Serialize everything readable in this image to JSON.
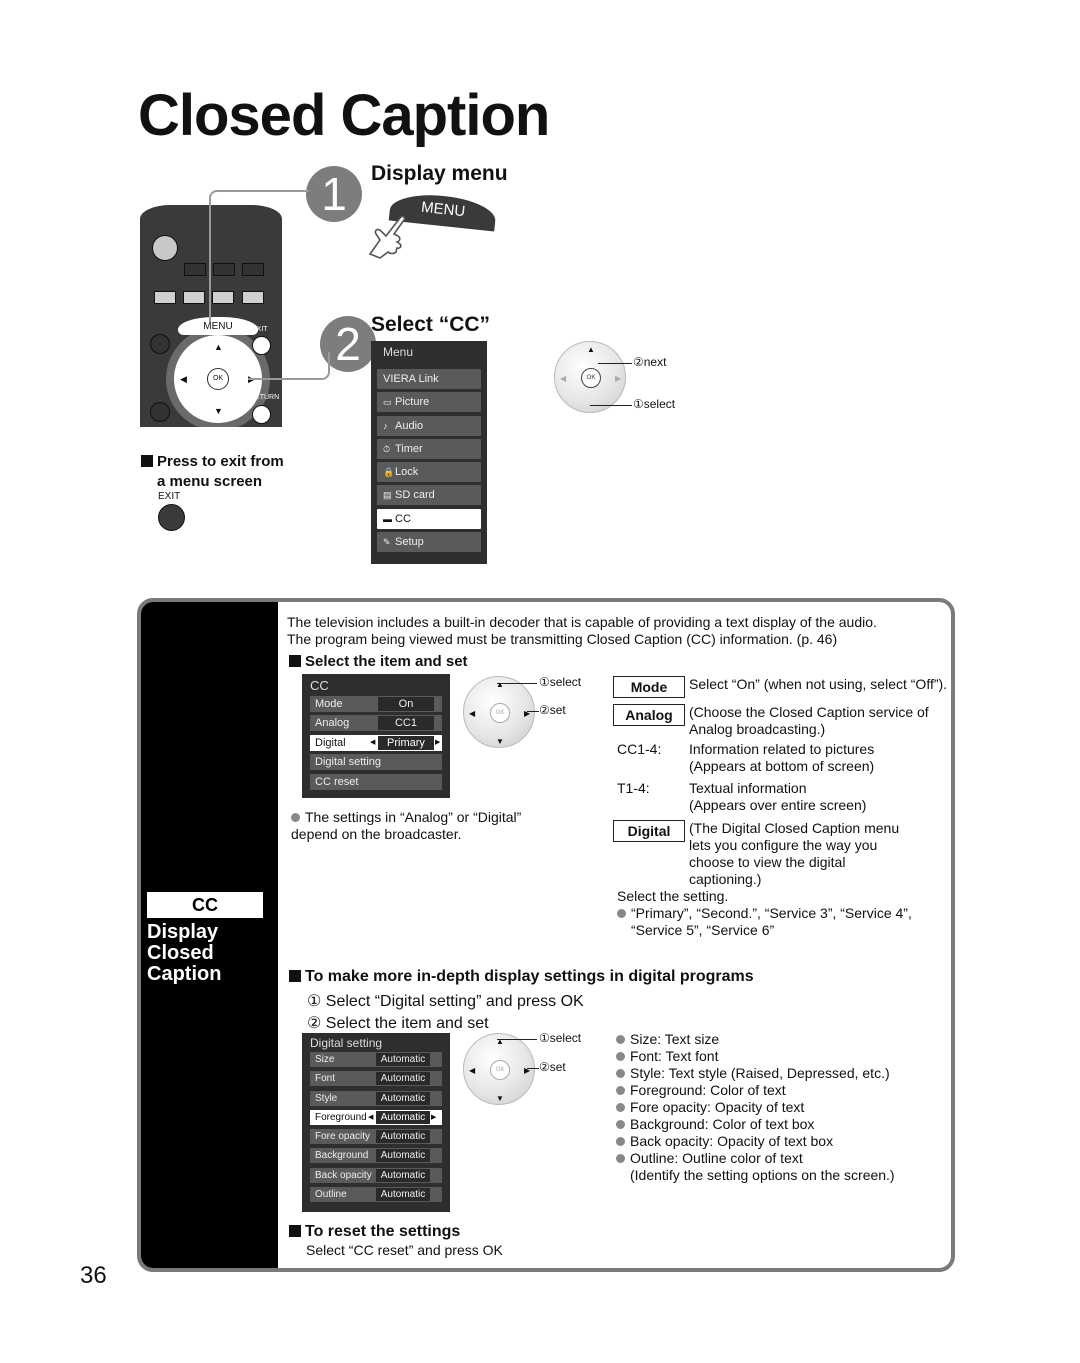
{
  "page": {
    "title": "Closed Caption",
    "page_number": "36"
  },
  "step1": {
    "number": "1",
    "heading": "Display menu",
    "menu_button_label": "MENU"
  },
  "step2": {
    "number": "2",
    "heading": "Select “CC”"
  },
  "remote": {
    "menu_label": "MENU",
    "exit_label": "EXIT",
    "return_label": "RETURN",
    "ok_label": "OK"
  },
  "tv_menu": {
    "header": "Menu",
    "items": [
      {
        "icon": "",
        "label": "VIERA Link",
        "selected": false
      },
      {
        "icon": "▭",
        "label": "Picture",
        "selected": false
      },
      {
        "icon": "♪",
        "label": "Audio",
        "selected": false
      },
      {
        "icon": "⏱",
        "label": "Timer",
        "selected": false
      },
      {
        "icon": "🔒",
        "label": "Lock",
        "selected": false
      },
      {
        "icon": "▤",
        "label": "SD card",
        "selected": false
      },
      {
        "icon": "▬",
        "label": "CC",
        "selected": true
      },
      {
        "icon": "✎",
        "label": "Setup",
        "selected": false
      }
    ]
  },
  "nav_pad_top": {
    "ok": "OK",
    "next_label": "②next",
    "select_label": "①select"
  },
  "exit_note": {
    "line1": "Press to exit from",
    "line2": "a menu screen",
    "exit_label": "EXIT"
  },
  "sidebar": {
    "badge": "CC",
    "title_lines": [
      "Display",
      "Closed",
      "Caption"
    ]
  },
  "intro": {
    "line1": "The television includes a built-in decoder that is capable of providing a text display of the audio.",
    "line2": "The program being viewed must be transmitting Closed Caption (CC) information. (p. 46)"
  },
  "select_item": {
    "heading": "Select the item and set",
    "cc_menu": {
      "title": "CC",
      "rows": [
        {
          "label": "Mode",
          "value": "On",
          "selected": false
        },
        {
          "label": "Analog",
          "value": "CC1",
          "selected": false
        },
        {
          "label": "Digital",
          "value": "Primary",
          "selected": true
        },
        {
          "label": "Digital setting",
          "value": "",
          "selected": false
        },
        {
          "label": "CC reset",
          "value": "",
          "selected": false
        }
      ]
    },
    "pad": {
      "ok": "OK",
      "select_label": "①select",
      "set_label": "②set"
    },
    "note": "The settings in “Analog” or “Digital” depend on the broadcaster."
  },
  "definitions": {
    "mode": {
      "label": "Mode",
      "text": "Select “On” (when not using, select “Off”)."
    },
    "analog": {
      "label": "Analog",
      "text": "(Choose the Closed Caption service of Analog broadcasting.)"
    },
    "cc14": {
      "term": "CC1-4:",
      "line1": "Information related to pictures",
      "line2": "(Appears at bottom of screen)"
    },
    "t14": {
      "term": "T1-4:",
      "line1": "Textual information",
      "line2": "(Appears over entire screen)"
    },
    "digital": {
      "label": "Digital",
      "text": "(The Digital Closed Caption menu lets you configure the way you choose to view the digital captioning.)"
    },
    "select_setting": "Select the setting.",
    "options": "“Primary”, “Second.”, “Service 3”, “Service 4”, “Service 5”, “Service 6”"
  },
  "in_depth": {
    "heading": "To make more in-depth display settings in digital programs",
    "step1": "① Select “Digital setting” and press OK",
    "step2": "② Select the item and set",
    "menu": {
      "title": "Digital setting",
      "rows": [
        {
          "label": "Size",
          "value": "Automatic",
          "selected": false
        },
        {
          "label": "Font",
          "value": "Automatic",
          "selected": false
        },
        {
          "label": "Style",
          "value": "Automatic",
          "selected": false
        },
        {
          "label": "Foreground",
          "value": "Automatic",
          "selected": true
        },
        {
          "label": "Fore opacity",
          "value": "Automatic",
          "selected": false
        },
        {
          "label": "Background",
          "value": "Automatic",
          "selected": false
        },
        {
          "label": "Back opacity",
          "value": "Automatic",
          "selected": false
        },
        {
          "label": "Outline",
          "value": "Automatic",
          "selected": false
        }
      ]
    },
    "pad": {
      "ok": "OK",
      "select_label": "①select",
      "set_label": "②set"
    },
    "bullets": [
      "Size:  Text size",
      "Font:  Text font",
      "Style:  Text style (Raised, Depressed, etc.)",
      "Foreground:  Color of text",
      "Fore opacity:  Opacity of text",
      "Background:  Color of text box",
      "Back opacity:  Opacity of text box",
      "Outline:  Outline color of text"
    ],
    "footnote": "(Identify the setting options on the screen.)"
  },
  "reset": {
    "heading": "To reset the settings",
    "text": "Select “CC reset” and press OK"
  }
}
